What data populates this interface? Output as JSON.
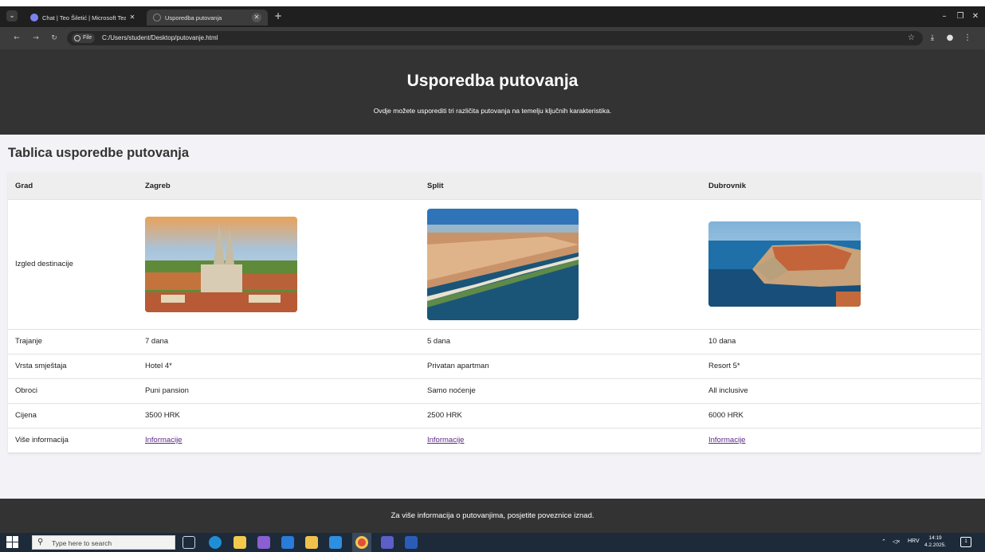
{
  "browser": {
    "tabs": [
      {
        "title": "Chat | Teo Šiletić | Microsoft Tea",
        "active": false
      },
      {
        "title": "Usporedba putovanja",
        "active": true
      }
    ],
    "site_chip": "File",
    "url": "C:/Users/student/Desktop/putovanje.html"
  },
  "page": {
    "title": "Usporedba putovanja",
    "subtitle": "Ovdje možete usporediti tri različita putovanja na temelju ključnih karakteristika.",
    "section_title": "Tablica usporedbe putovanja",
    "table": {
      "header": [
        "Grad",
        "Zagreb",
        "Split",
        "Dubrovnik"
      ],
      "image_row_label": "Izgled destinacije",
      "rows": [
        {
          "label": "Trajanje",
          "values": [
            "7 dana",
            "5 dana",
            "10 dana"
          ]
        },
        {
          "label": "Vrsta smještaja",
          "values": [
            "Hotel 4*",
            "Privatan apartman",
            "Resort 5*"
          ]
        },
        {
          "label": "Obroci",
          "values": [
            "Puni pansion",
            "Samo noćenje",
            "All inclusive"
          ]
        },
        {
          "label": "Cijena",
          "values": [
            "3500 HRK",
            "2500 HRK",
            "6000 HRK"
          ]
        }
      ],
      "links_label": "Više informacija",
      "links": [
        "Informacije",
        "Informacije",
        "Informacije"
      ]
    },
    "footer": "Za više informacija o putovanjima, posjetite poveznice iznad."
  },
  "taskbar": {
    "search_placeholder": "Type here to search",
    "language": "HRV",
    "time": "14:19",
    "date": "4.2.2025."
  },
  "colors": {
    "header_bg": "#333333",
    "page_bg": "#f3f3f7",
    "link": "#5b2a86",
    "taskbar_bg": "#1c2a3a"
  }
}
